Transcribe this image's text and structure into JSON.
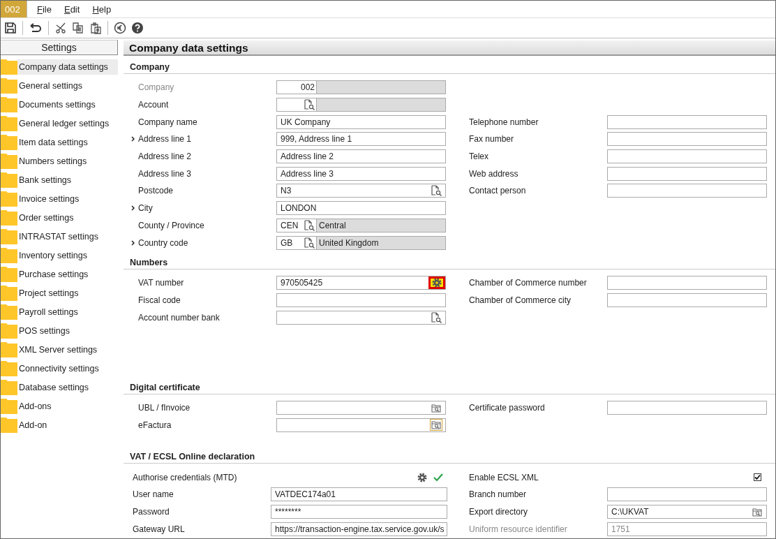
{
  "menu_bar": {
    "company_badge": "002",
    "items": [
      "File",
      "Edit",
      "Help"
    ]
  },
  "sidebar": {
    "title": "Settings",
    "items": [
      {
        "label": "Company data settings",
        "selected": true
      },
      {
        "label": "General settings",
        "selected": false
      },
      {
        "label": "Documents settings",
        "selected": false
      },
      {
        "label": "General ledger settings",
        "selected": false
      },
      {
        "label": "Item data settings",
        "selected": false
      },
      {
        "label": "Numbers settings",
        "selected": false
      },
      {
        "label": "Bank settings",
        "selected": false
      },
      {
        "label": "Invoice settings",
        "selected": false
      },
      {
        "label": "Order settings",
        "selected": false
      },
      {
        "label": "INTRASTAT settings",
        "selected": false
      },
      {
        "label": "Inventory settings",
        "selected": false
      },
      {
        "label": "Purchase settings",
        "selected": false
      },
      {
        "label": "Project settings",
        "selected": false
      },
      {
        "label": "Payroll settings",
        "selected": false
      },
      {
        "label": "POS settings",
        "selected": false
      },
      {
        "label": "XML Server settings",
        "selected": false
      },
      {
        "label": "Connectivity settings",
        "selected": false
      },
      {
        "label": "Database settings",
        "selected": false
      },
      {
        "label": "Add-ons",
        "selected": false
      },
      {
        "label": "Add-on",
        "selected": false
      }
    ]
  },
  "panel": {
    "title": "Company data settings",
    "sections": [
      {
        "title": "Company",
        "rows": [
          {
            "left": {
              "label": "Company",
              "kind": "code_desc",
              "code": "002",
              "expandable": false,
              "disabled": true
            }
          },
          {
            "left": {
              "label": "Account",
              "kind": "code_lookup",
              "expandable": false,
              "disabled": false
            }
          },
          {
            "left": {
              "label": "Company name",
              "kind": "text",
              "value": "UK Company",
              "expandable": false,
              "disabled": false
            },
            "right": {
              "label": "Telephone number",
              "kind": "text",
              "expandable": false,
              "disabled": false
            }
          },
          {
            "left": {
              "label": "Address line 1",
              "kind": "text",
              "value": "999, Address line 1",
              "expandable": true,
              "disabled": false
            },
            "right": {
              "label": "Fax number",
              "kind": "text",
              "expandable": false,
              "disabled": false
            }
          },
          {
            "left": {
              "label": "Address line 2",
              "kind": "text",
              "value": "Address line 2",
              "expandable": false,
              "disabled": false
            },
            "right": {
              "label": "Telex",
              "kind": "text",
              "expandable": false,
              "disabled": false
            }
          },
          {
            "left": {
              "label": "Address line 3",
              "kind": "text",
              "value": "Address line 3",
              "expandable": false,
              "disabled": false
            },
            "right": {
              "label": "Web address",
              "kind": "text",
              "expandable": false,
              "disabled": false
            }
          },
          {
            "left": {
              "label": "Postcode",
              "kind": "lookup",
              "value": "N3",
              "expandable": false,
              "disabled": false
            },
            "right": {
              "label": "Contact person",
              "kind": "text",
              "expandable": false,
              "disabled": false
            }
          },
          {
            "left": {
              "label": "City",
              "kind": "text",
              "value": "LONDON",
              "expandable": true,
              "disabled": false
            }
          },
          {
            "left": {
              "label": "County / Province",
              "kind": "code_lookup",
              "code": "CEN",
              "description": "Central",
              "expandable": false,
              "disabled": false
            }
          },
          {
            "left": {
              "label": "Country code",
              "kind": "code_lookup",
              "code": "GB",
              "description": "United Kingdom",
              "expandable": true,
              "disabled": false
            }
          }
        ]
      },
      {
        "title": "Numbers",
        "rows": [
          {
            "left": {
              "label": "VAT number",
              "kind": "gear",
              "value": "970505425",
              "highlighted": true,
              "expandable": false,
              "disabled": false
            },
            "right": {
              "label": "Chamber of Commerce number",
              "kind": "text",
              "expandable": false,
              "disabled": false
            }
          },
          {
            "left": {
              "label": "Fiscal code",
              "kind": "text",
              "expandable": false,
              "disabled": false
            },
            "right": {
              "label": "Chamber of Commerce city",
              "kind": "text",
              "expandable": false,
              "disabled": false
            }
          },
          {
            "left": {
              "label": "Account number bank",
              "kind": "lookup",
              "expandable": false,
              "disabled": false
            }
          }
        ]
      },
      {
        "title": "Digital certificate",
        "rows": [
          {
            "left": {
              "label": "UBL / fInvoice",
              "kind": "folder",
              "focused": false,
              "expandable": false,
              "disabled": false
            },
            "right": {
              "label": "Certificate password",
              "kind": "text",
              "expandable": false,
              "disabled": false
            }
          },
          {
            "left": {
              "label": "eFactura",
              "kind": "folder",
              "focused": true,
              "expandable": false,
              "disabled": false
            }
          }
        ]
      },
      {
        "title": "VAT / ECSL Online declaration",
        "rows": [
          {
            "left": {
              "label": "Authorise credentials (MTD)",
              "kind": "actions",
              "authorised": true,
              "expandable": false,
              "disabled": false
            },
            "right": {
              "label": "Enable ECSL XML",
              "kind": "checkbox",
              "checked": true,
              "expandable": false,
              "disabled": false
            }
          },
          {
            "left": {
              "label": "User name",
              "kind": "text",
              "value": "VATDEC174a01",
              "expandable": false,
              "disabled": false
            },
            "right": {
              "label": "Branch number",
              "kind": "text",
              "expandable": false,
              "disabled": false
            }
          },
          {
            "left": {
              "label": "Password",
              "kind": "text",
              "value": "********",
              "expandable": false,
              "disabled": false
            },
            "right": {
              "label": "Export directory",
              "kind": "folder",
              "value": "C:\\UKVAT",
              "focused": false,
              "expandable": false,
              "disabled": false
            }
          },
          {
            "left": {
              "label": "Gateway URL",
              "kind": "text",
              "value": "https://transaction-engine.tax.service.gov.uk/s",
              "expandable": false,
              "disabled": false
            },
            "right": {
              "label": "Uniform resource identifier",
              "kind": "text",
              "value": "1751",
              "expandable": false,
              "disabled": true
            }
          }
        ]
      }
    ]
  }
}
